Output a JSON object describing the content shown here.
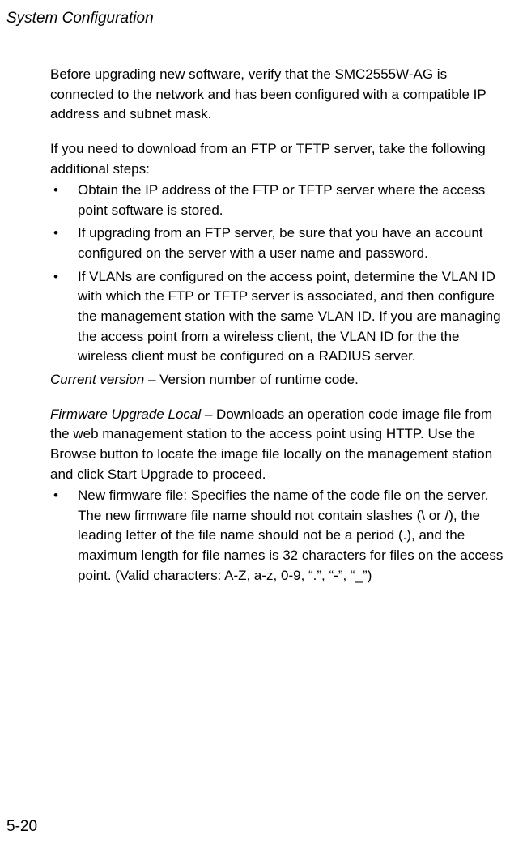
{
  "header": {
    "title": "System Configuration"
  },
  "content": {
    "para1": "Before upgrading new software, verify that the SMC2555W-AG is connected to the network and has been configured with a compatible IP address and subnet mask.",
    "para2": "If you need to download from an FTP or TFTP server, take the following additional steps:",
    "bullets1": [
      "Obtain the IP address of the FTP or TFTP server where the access point software is stored.",
      "If upgrading from an FTP server, be sure that you have an account configured on the server with a user name and password.",
      "If VLANs are configured on the access point, determine the VLAN ID with which the FTP or TFTP server is associated, and then configure the management station with the same VLAN ID. If you are managing the access point from a wireless client, the VLAN ID for the the wireless client must be configured on a RADIUS server."
    ],
    "current_version_label": "Current version",
    "current_version_text": " – Version number of runtime code.",
    "firmware_label": "Firmware Upgrade Local",
    "firmware_text": " – Downloads an operation code image file from the web management station to the access point using HTTP. Use the Browse button to locate the image file locally on the management station and click Start Upgrade to proceed.",
    "bullets2": [
      "New firmware file: Specifies the name of the code file on the server. The new firmware file name should not contain slashes (\\ or /), the leading letter of the file name should not be a period (.), and the maximum length for file names is 32 characters for files on the access point. (Valid characters: A-Z, a-z, 0-9, “.”, “-”, “_”)"
    ]
  },
  "footer": {
    "page_number": "5-20"
  }
}
